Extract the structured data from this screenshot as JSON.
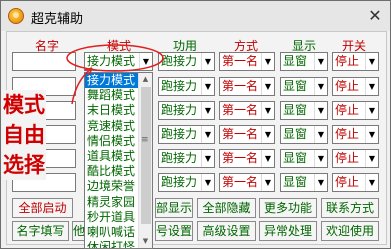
{
  "window": {
    "title": "超克辅助",
    "close_glyph": "✕"
  },
  "headers": {
    "name": "名字",
    "mode": "模式",
    "skill": "功用",
    "method": "方式",
    "display": "显示",
    "toggle": "开关"
  },
  "rows": [
    {
      "mode": "接力模式",
      "skill": "跑接力",
      "method": "第一名",
      "display": "显窗",
      "toggle": "停止"
    },
    {
      "mode": "",
      "skill": "跑接力",
      "method": "第一名",
      "display": "显窗",
      "toggle": "停止"
    },
    {
      "mode": "",
      "skill": "跑接力",
      "method": "第一名",
      "display": "显窗",
      "toggle": "停止"
    },
    {
      "mode": "",
      "skill": "跑接力",
      "method": "第一名",
      "display": "显窗",
      "toggle": "停止"
    },
    {
      "mode": "",
      "skill": "跑接力",
      "method": "第一名",
      "display": "显窗",
      "toggle": "停止"
    },
    {
      "mode": "",
      "skill": "跑接力",
      "method": "第一名",
      "display": "显窗",
      "toggle": "停止"
    }
  ],
  "dropdown_items": [
    "接力模式",
    "舞蹈模式",
    "末日模式",
    "竞速模式",
    "情侣模式",
    "道具模式",
    "酷比模式",
    "边境荣誉",
    "精灵家园",
    "秒开道具",
    "喇叭喊话",
    "休闲打怪"
  ],
  "dropdown_selected_index": 0,
  "buttons_row1": {
    "start_all": "全部启动",
    "show_all": "部显示",
    "hide_all": "全部隐藏",
    "more": "更多功能",
    "contact": "联系方式"
  },
  "buttons_row2": {
    "fill_names": "名字填写",
    "he": "他",
    "account": "号设置",
    "advanced": "高级设置",
    "exception": "异常处理",
    "welcome": "欢迎使用"
  },
  "annotation": [
    "模式",
    "自由",
    "选择"
  ],
  "colors": {
    "label_red": "#c00000",
    "value_green": "#006600",
    "highlight": "#0078d7"
  }
}
